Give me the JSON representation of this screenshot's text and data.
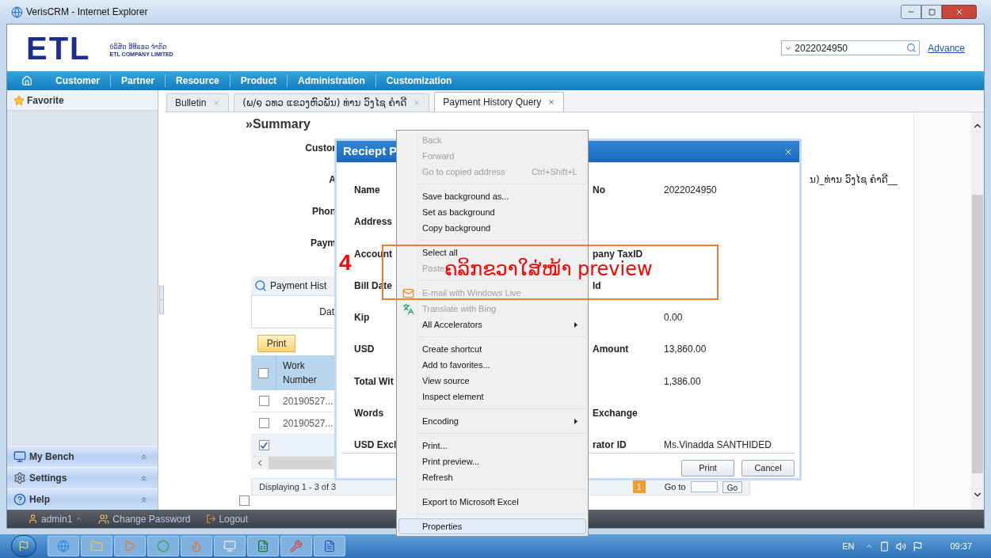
{
  "window": {
    "title": "VerisCRM - Internet Explorer"
  },
  "header": {
    "logo": "ETL",
    "company_lao": "ບໍລິສັດ ອີທີແອລ ຈຳກັດ",
    "company_en": "ETL COMPANY LIMITED",
    "search": {
      "value": "2022024950"
    },
    "advance_link": "Advance"
  },
  "nav": [
    "Customer",
    "Partner",
    "Resource",
    "Product",
    "Administration",
    "Customization"
  ],
  "sidebar": {
    "favorite": "Favorite",
    "panels": [
      {
        "label": "My Bench",
        "kind": "bench"
      },
      {
        "label": "Settings",
        "kind": "settings"
      },
      {
        "label": "Help",
        "kind": "help"
      }
    ]
  },
  "tabs": [
    {
      "label": "Bulletin",
      "selected": false
    },
    {
      "label": "(ພ/໑ ວທວ ແຂວງຫົວພັນ) ທ່ານ ວົງໄຊ ຄຳດີ",
      "selected": false
    },
    {
      "label": "Payment History Query",
      "selected": true
    }
  ],
  "summary": {
    "title": "»Summary",
    "rows": [
      {
        "label": "Custor"
      },
      {
        "label": "A",
        "value": "ນ)_ທ່ານ ວົງໄຊ ຄຳດີ__"
      },
      {
        "label": "Phon"
      },
      {
        "label": "Paym"
      }
    ]
  },
  "payment_history": {
    "title": "Payment Hist",
    "filter_label": "Dat",
    "print_button": "Print",
    "grid": {
      "header_checked": false,
      "column": "Work Number",
      "rows": [
        {
          "work_number": "20190527...",
          "checked": false
        },
        {
          "work_number": "20190527...",
          "checked": false
        },
        {
          "checked": true
        }
      ]
    },
    "paging": {
      "summary": "Displaying 1 - 3 of 3",
      "page": "1",
      "goto_label": "Go to",
      "go_button": "Go"
    },
    "footer_checked": false
  },
  "dialog": {
    "title": "Reciept P",
    "rows": [
      {
        "label": "Name",
        "right_label": "No",
        "right_value": "2022024950"
      },
      {
        "label": "Address"
      },
      {
        "label": "Account",
        "right_label": "pany TaxID"
      },
      {
        "label": "Bill Date",
        "right_label": "Id"
      },
      {
        "label": "Kip",
        "right_value": "0.00"
      },
      {
        "label": "USD",
        "right_label": "Amount",
        "right_value": "13,860.00"
      },
      {
        "label": "Total Wit",
        "right_value": "1,386.00"
      },
      {
        "label": "Words",
        "right_label": "Exchange"
      },
      {
        "label": "USD Excl",
        "right_label": "rator ID",
        "right_value": "Ms.Vinadda SANTHIDED"
      }
    ],
    "buttons": [
      "Print",
      "Cancel"
    ]
  },
  "context_menu": {
    "items": [
      {
        "kind": "item",
        "label": "Back",
        "disabled": true,
        "selected": false
      },
      {
        "kind": "item",
        "label": "Forward",
        "disabled": true,
        "selected": false
      },
      {
        "kind": "item",
        "label": "Go to copied address",
        "shortcut": "Ctrl+Shift+L",
        "disabled": true,
        "selected": false
      },
      {
        "kind": "separator"
      },
      {
        "kind": "item",
        "label": "Save background as...",
        "disabled": false,
        "selected": false
      },
      {
        "kind": "item",
        "label": "Set as background",
        "disabled": false,
        "selected": false
      },
      {
        "kind": "item",
        "label": "Copy background",
        "disabled": false,
        "selected": false
      },
      {
        "kind": "separator"
      },
      {
        "kind": "item",
        "label": "Select all",
        "disabled": false,
        "selected": false
      },
      {
        "kind": "item",
        "label": "Paste",
        "disabled": true,
        "selected": false
      },
      {
        "kind": "separator"
      },
      {
        "kind": "icon-item",
        "label": "E-mail with Windows Live",
        "disabled": true,
        "selected": false
      },
      {
        "kind": "icon-item",
        "label": "Translate with Bing",
        "disabled": true,
        "selected": false
      },
      {
        "kind": "item",
        "label": "All Accelerators",
        "submenu": true,
        "disabled": false,
        "selected": false
      },
      {
        "kind": "separator"
      },
      {
        "kind": "item",
        "label": "Create shortcut",
        "disabled": false,
        "selected": false
      },
      {
        "kind": "item",
        "label": "Add to favorites...",
        "disabled": false,
        "selected": false
      },
      {
        "kind": "item",
        "label": "View source",
        "disabled": false,
        "selected": false
      },
      {
        "kind": "item",
        "label": "Inspect element",
        "disabled": false,
        "selected": false
      },
      {
        "kind": "separator"
      },
      {
        "kind": "item",
        "label": "Encoding",
        "submenu": true,
        "disabled": false,
        "selected": false
      },
      {
        "kind": "separator"
      },
      {
        "kind": "item",
        "label": "Print...",
        "disabled": false,
        "selected": false
      },
      {
        "kind": "item",
        "label": "Print preview...",
        "disabled": false,
        "selected": false
      },
      {
        "kind": "item",
        "label": "Refresh",
        "disabled": false,
        "selected": false
      },
      {
        "kind": "separator"
      },
      {
        "kind": "item",
        "label": "Export to Microsoft Excel",
        "disabled": false,
        "selected": false
      },
      {
        "kind": "separator"
      },
      {
        "kind": "item",
        "label": "Properties",
        "disabled": false,
        "selected": true
      }
    ]
  },
  "annotation": {
    "step": "4",
    "text": "ຄລິກຂວາໃສ່ໜ້າ preview"
  },
  "status_bar": {
    "user": "admin1",
    "change_password": "Change Password",
    "logout": "Logout"
  },
  "taskbar": {
    "language": "EN",
    "time": "09:37"
  }
}
